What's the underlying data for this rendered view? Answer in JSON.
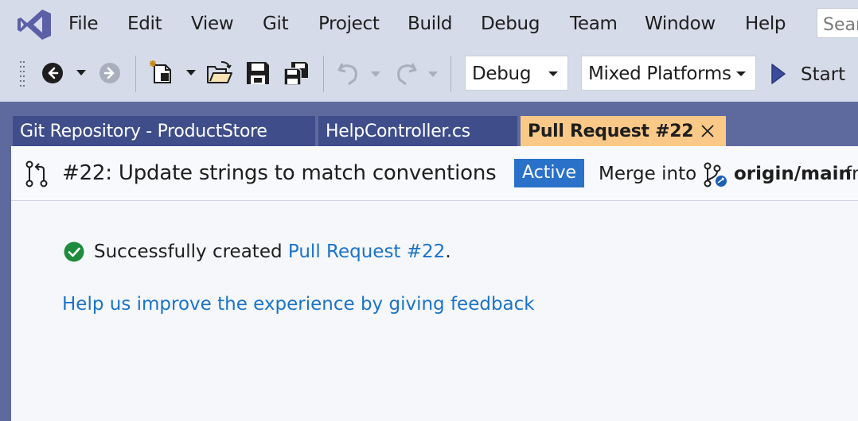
{
  "colors": {
    "chrome_bg": "#d6dbe9",
    "frame_bg": "#5e6a9e",
    "inactive_tab": "#3f4d8a",
    "active_tab": "#fbc987",
    "badge": "#2a71c9",
    "link": "#1a73c7",
    "success": "#1e8c3c"
  },
  "menu": {
    "items": [
      "File",
      "Edit",
      "View",
      "Git",
      "Project",
      "Build",
      "Debug",
      "Team",
      "Window",
      "Help"
    ],
    "search_placeholder": "Search"
  },
  "toolbar": {
    "icons": [
      "back-icon",
      "forward-icon",
      "new-project-icon",
      "open-folder-icon",
      "save-icon",
      "save-all-icon",
      "undo-icon",
      "redo-icon",
      "start-icon"
    ],
    "configuration": "Debug",
    "platform": "Mixed Platforms",
    "start_label": "Start"
  },
  "tabs": [
    {
      "label": "Git Repository - ProductStore",
      "active": false
    },
    {
      "label": "HelpController.cs",
      "active": false
    },
    {
      "label": "Pull Request #22",
      "active": true
    }
  ],
  "pull_request": {
    "title": "#22: Update strings to match conventions",
    "status": "Active",
    "merge_label": "Merge into",
    "target_branch": "origin/main",
    "from_label": "from"
  },
  "content": {
    "success_prefix": "Successfully created ",
    "success_link": "Pull Request #22",
    "success_suffix": ".",
    "feedback_link": "Help us improve the experience by giving feedback"
  }
}
